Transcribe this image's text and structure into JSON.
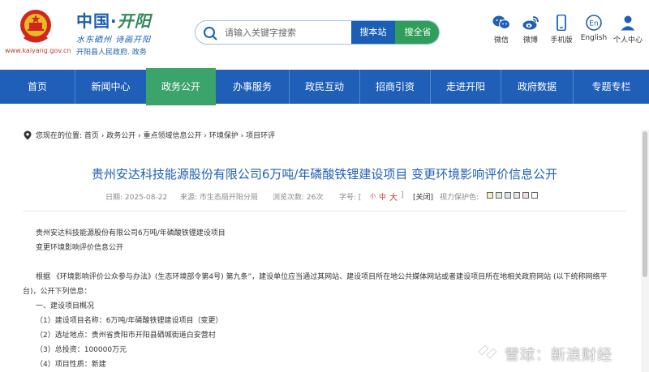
{
  "header": {
    "site_url": "www.kaiyang.gov.cn",
    "brand_title_main": "中国·",
    "brand_title_accent": "开阳",
    "slogan": "水东硒州 诗画开阳",
    "subtitle": "开阳县人民政府. 政务",
    "search": {
      "placeholder": "请输入关键字搜索",
      "btn_site": "搜本站",
      "btn_all": "搜全省"
    },
    "tools": [
      {
        "label": "微信",
        "icon": "wechat-icon"
      },
      {
        "label": "微博",
        "icon": "weibo-icon"
      },
      {
        "label": "手机版",
        "icon": "mobile-icon"
      },
      {
        "label": "English",
        "icon": "english-icon"
      },
      {
        "label": "个人中心",
        "icon": "user-icon"
      }
    ],
    "english_badge": "En"
  },
  "nav": {
    "items": [
      "首页",
      "新闻中心",
      "政务公开",
      "办事服务",
      "政民互动",
      "招商引资",
      "走进开阳",
      "政府数据",
      "专题专栏"
    ],
    "active_index": 2
  },
  "breadcrumb": {
    "text": "您现在的位置: 首页 › 政务公开 › 重点领域信息公开 › 环境保护 › 项目环评"
  },
  "article": {
    "title": "贵州安达科技能源股份有限公司6万吨/年磷酸铁锂建设项目 变更环境影响评价信息公开",
    "meta": {
      "date": "日期: 2025-08-22",
      "source": "来源: 市生态局开阳分局",
      "views": "浏览次数: 26次",
      "font_label": "字号: [",
      "font_small": "小",
      "font_mid": "中",
      "font_big": "大",
      "font_end": "]",
      "close": "[关闭]",
      "eye_label": "视力保护色:"
    },
    "swatches": [
      "#f5edc8",
      "#dcecd8",
      "#d8e4f2",
      "#e6e6e6",
      "#f0dcec",
      "#ffffff"
    ],
    "lines": [
      "贵州安达科技能源股份有限公司6万吨/年磷酸铁锂建设项目",
      "变更环境影响评价信息公开",
      "根据 《环境影响评价公众参与办法》(生态环境部令第4号) 第九条”，建设单位应当通过其网站、建设项目所在地公共媒体网站或者建设项目所在地相关政府网站 (以下统称网络平",
      "台)，公开下列信息：",
      "一、建设项目概况",
      "（1）建设项目名称：6万吨/年磷酸铁锂建设项目（变更）",
      "（2）选址地点：贵州省贵阳市开阳县硒城街道白安营村",
      "（3）总投资：100000万元",
      "（4）项目性质：新建"
    ]
  },
  "watermark": {
    "text": "雪球：新浪财经"
  },
  "colors": {
    "primary_blue": "#1f5fb8",
    "active_green": "#3aa46a",
    "search_green": "#2e9e58",
    "emblem_red": "#d0261d"
  }
}
